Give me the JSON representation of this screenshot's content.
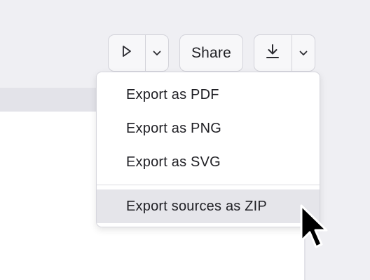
{
  "toolbar": {
    "share_label": "Share"
  },
  "export_menu": {
    "items": [
      {
        "label": "Export as PDF"
      },
      {
        "label": "Export as PNG"
      },
      {
        "label": "Export as SVG"
      }
    ],
    "highlighted_item": {
      "label": "Export sources as ZIP"
    }
  },
  "icons": {
    "run": "play-icon",
    "run_menu": "chevron-down-icon",
    "download": "download-icon",
    "download_menu": "chevron-down-icon",
    "pointer": "mouse-pointer-icon"
  },
  "colors": {
    "background": "#efeff3",
    "button_bg": "#f7f7f9",
    "menu_bg": "#ffffff",
    "menu_highlight": "#e5e5ea",
    "text": "#1f1f24"
  }
}
